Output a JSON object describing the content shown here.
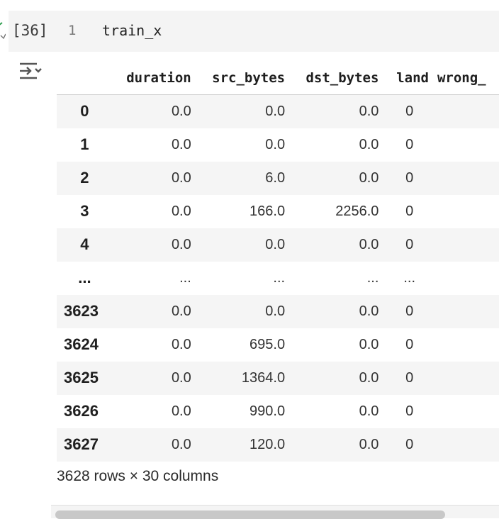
{
  "cell": {
    "execution_count": "[36]",
    "line_number": "1",
    "code": "train_x"
  },
  "output": {
    "columns": [
      "",
      "duration",
      "src_bytes",
      "dst_bytes",
      "land",
      "wrong_"
    ],
    "rows": [
      {
        "index": "0",
        "duration": "0.0",
        "src_bytes": "0.0",
        "dst_bytes": "0.0",
        "land": "0"
      },
      {
        "index": "1",
        "duration": "0.0",
        "src_bytes": "0.0",
        "dst_bytes": "0.0",
        "land": "0"
      },
      {
        "index": "2",
        "duration": "0.0",
        "src_bytes": "6.0",
        "dst_bytes": "0.0",
        "land": "0"
      },
      {
        "index": "3",
        "duration": "0.0",
        "src_bytes": "166.0",
        "dst_bytes": "2256.0",
        "land": "0"
      },
      {
        "index": "4",
        "duration": "0.0",
        "src_bytes": "0.0",
        "dst_bytes": "0.0",
        "land": "0"
      },
      {
        "index": "...",
        "duration": "...",
        "src_bytes": "...",
        "dst_bytes": "...",
        "land": "..."
      },
      {
        "index": "3623",
        "duration": "0.0",
        "src_bytes": "0.0",
        "dst_bytes": "0.0",
        "land": "0"
      },
      {
        "index": "3624",
        "duration": "0.0",
        "src_bytes": "695.0",
        "dst_bytes": "0.0",
        "land": "0"
      },
      {
        "index": "3625",
        "duration": "0.0",
        "src_bytes": "1364.0",
        "dst_bytes": "0.0",
        "land": "0"
      },
      {
        "index": "3626",
        "duration": "0.0",
        "src_bytes": "990.0",
        "dst_bytes": "0.0",
        "land": "0"
      },
      {
        "index": "3627",
        "duration": "0.0",
        "src_bytes": "120.0",
        "dst_bytes": "0.0",
        "land": "0"
      }
    ],
    "shape_text": "3628 rows × 30 columns"
  },
  "icons": {
    "output_toggle": "output-actions-icon",
    "run_status": "check-icon"
  },
  "colors": {
    "cell_background": "#f4f4f4",
    "stripe": "#f5f5f5",
    "run_check": "#2e9e4f"
  }
}
